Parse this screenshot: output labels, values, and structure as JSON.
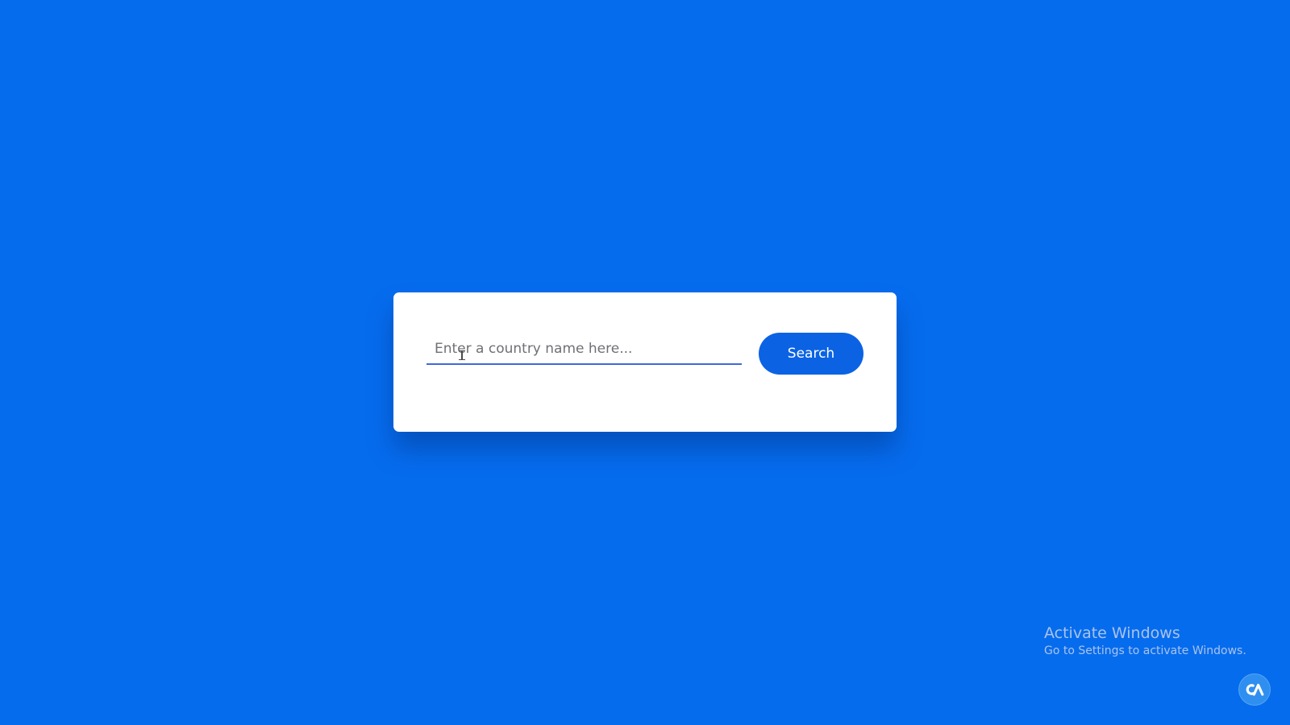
{
  "search": {
    "placeholder": "Enter a country name here...",
    "value": "",
    "button_label": "Search"
  },
  "watermark": {
    "title": "Activate Windows",
    "subtitle": "Go to Settings to activate Windows."
  },
  "icons": {
    "text_cursor": "i-beam-cursor-icon",
    "corner_widget": "app-logo-icon"
  },
  "colors": {
    "background": "#066cee",
    "card": "#ffffff",
    "accent": "#0b63e4",
    "input_underline": "#3f69d8",
    "placeholder": "#6f7075"
  }
}
